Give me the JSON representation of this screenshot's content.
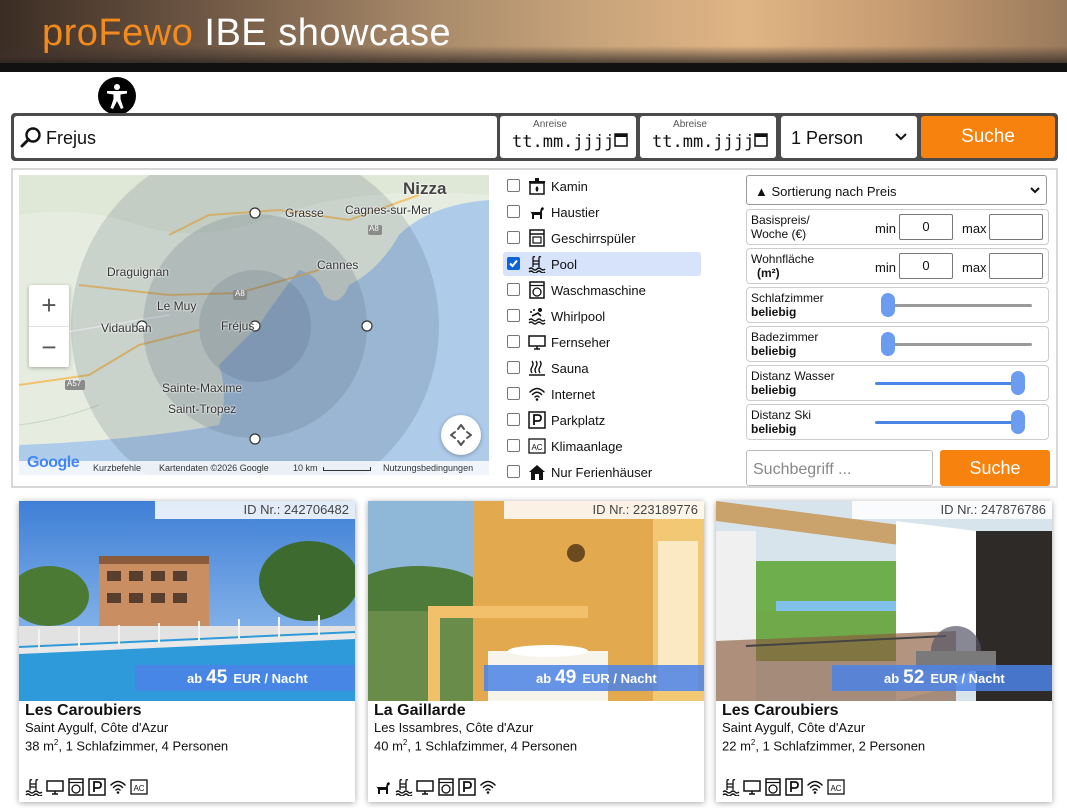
{
  "header": {
    "brand_pro": "proFewo",
    "brand_rest": " IBE showcase"
  },
  "search": {
    "destination": "Frejus",
    "arrival_label": "Anreise",
    "arrival_value": "tt.mm.jjjj",
    "departure_label": "Abreise",
    "departure_value": "tt.mm.jjjj",
    "persons": "1 Person",
    "button": "Suche"
  },
  "map": {
    "labels": [
      "Nizza",
      "Grasse",
      "Cagnes-sur-Mer",
      "Cannes",
      "Draguignan",
      "Le Muy",
      "Vidauban",
      "Fréjus",
      "Sainte-Maxime",
      "Saint-Tropez",
      "A8",
      "A8",
      "A57"
    ],
    "logo": "Google",
    "footer": {
      "shortcuts": "Kurzbefehle",
      "data": "Kartendaten ©2026 Google",
      "scale": "10 km",
      "terms": "Nutzungsbedingungen"
    },
    "zoom_in": "+",
    "zoom_out": "−"
  },
  "amenities": [
    {
      "label": "Kamin",
      "icon": "fireplace-icon",
      "checked": false
    },
    {
      "label": "Haustier",
      "icon": "pet-icon",
      "checked": false
    },
    {
      "label": "Geschirrspüler",
      "icon": "dishwasher-icon",
      "checked": false
    },
    {
      "label": "Pool",
      "icon": "pool-icon",
      "checked": true
    },
    {
      "label": "Waschmaschine",
      "icon": "washing-machine-icon",
      "checked": false
    },
    {
      "label": "Whirlpool",
      "icon": "whirlpool-icon",
      "checked": false
    },
    {
      "label": "Fernseher",
      "icon": "tv-icon",
      "checked": false
    },
    {
      "label": "Sauna",
      "icon": "sauna-icon",
      "checked": false
    },
    {
      "label": "Internet",
      "icon": "wifi-icon",
      "checked": false
    },
    {
      "label": "Parkplatz",
      "icon": "parking-icon",
      "checked": false
    },
    {
      "label": "Klimaanlage",
      "icon": "ac-icon",
      "checked": false
    },
    {
      "label": "Nur Ferienhäuser",
      "icon": "house-icon",
      "checked": false
    }
  ],
  "filters": {
    "sort": "▲ Sortierung nach Preis",
    "price": {
      "label1": "Basispreis/",
      "label2": "Woche (€)",
      "min_label": "min",
      "min": "0",
      "max_label": "max",
      "max": ""
    },
    "area": {
      "label1": "Wohnfläche",
      "label2": "(m²)",
      "min_label": "min",
      "min": "0",
      "max_label": "max",
      "max": ""
    },
    "bedrooms": {
      "label": "Schlafzimmer",
      "value": "beliebig",
      "level": 0
    },
    "bathrooms": {
      "label": "Badezimmer",
      "value": "beliebig",
      "level": 0
    },
    "water": {
      "label": "Distanz Wasser",
      "value": "beliebig",
      "level": 1
    },
    "ski": {
      "label": "Distanz Ski",
      "value": "beliebig",
      "level": 1
    },
    "keyword_placeholder": "Suchbegriff ...",
    "button": "Suche"
  },
  "cards": [
    {
      "id": "ID Nr.: 242706482",
      "price_prefix": "ab",
      "price": "45",
      "price_unit": "EUR / Nacht",
      "name": "Les Caroubiers",
      "location": "Saint Aygulf, Côte d'Azur",
      "area": "38 m",
      "details": ", 1 Schlafzimmer, 4 Personen",
      "icons": [
        "pool-icon",
        "tv-icon",
        "washing-machine-icon",
        "parking-icon",
        "wifi-icon",
        "ac-icon"
      ]
    },
    {
      "id": "ID Nr.: 223189776",
      "price_prefix": "ab",
      "price": "49",
      "price_unit": "EUR / Nacht",
      "name": "La Gaillarde",
      "location": "Les Issambres, Côte d'Azur",
      "area": "40 m",
      "details": ", 1 Schlafzimmer, 4 Personen",
      "icons": [
        "pet-icon",
        "pool-icon",
        "tv-icon",
        "washing-machine-icon",
        "parking-icon",
        "wifi-icon"
      ]
    },
    {
      "id": "ID Nr.: 247876786",
      "price_prefix": "ab",
      "price": "52",
      "price_unit": "EUR / Nacht",
      "name": "Les Caroubiers",
      "location": "Saint Aygulf, Côte d'Azur",
      "area": "22 m",
      "details": ", 1 Schlafzimmer, 2 Personen",
      "icons": [
        "pool-icon",
        "tv-icon",
        "washing-machine-icon",
        "parking-icon",
        "wifi-icon",
        "ac-icon"
      ]
    }
  ],
  "colors": {
    "accent_orange": "#f7820d",
    "brand_orange": "#f28a1e",
    "price_blue": "#4b82e6",
    "slider_blue": "#4a86e8"
  }
}
